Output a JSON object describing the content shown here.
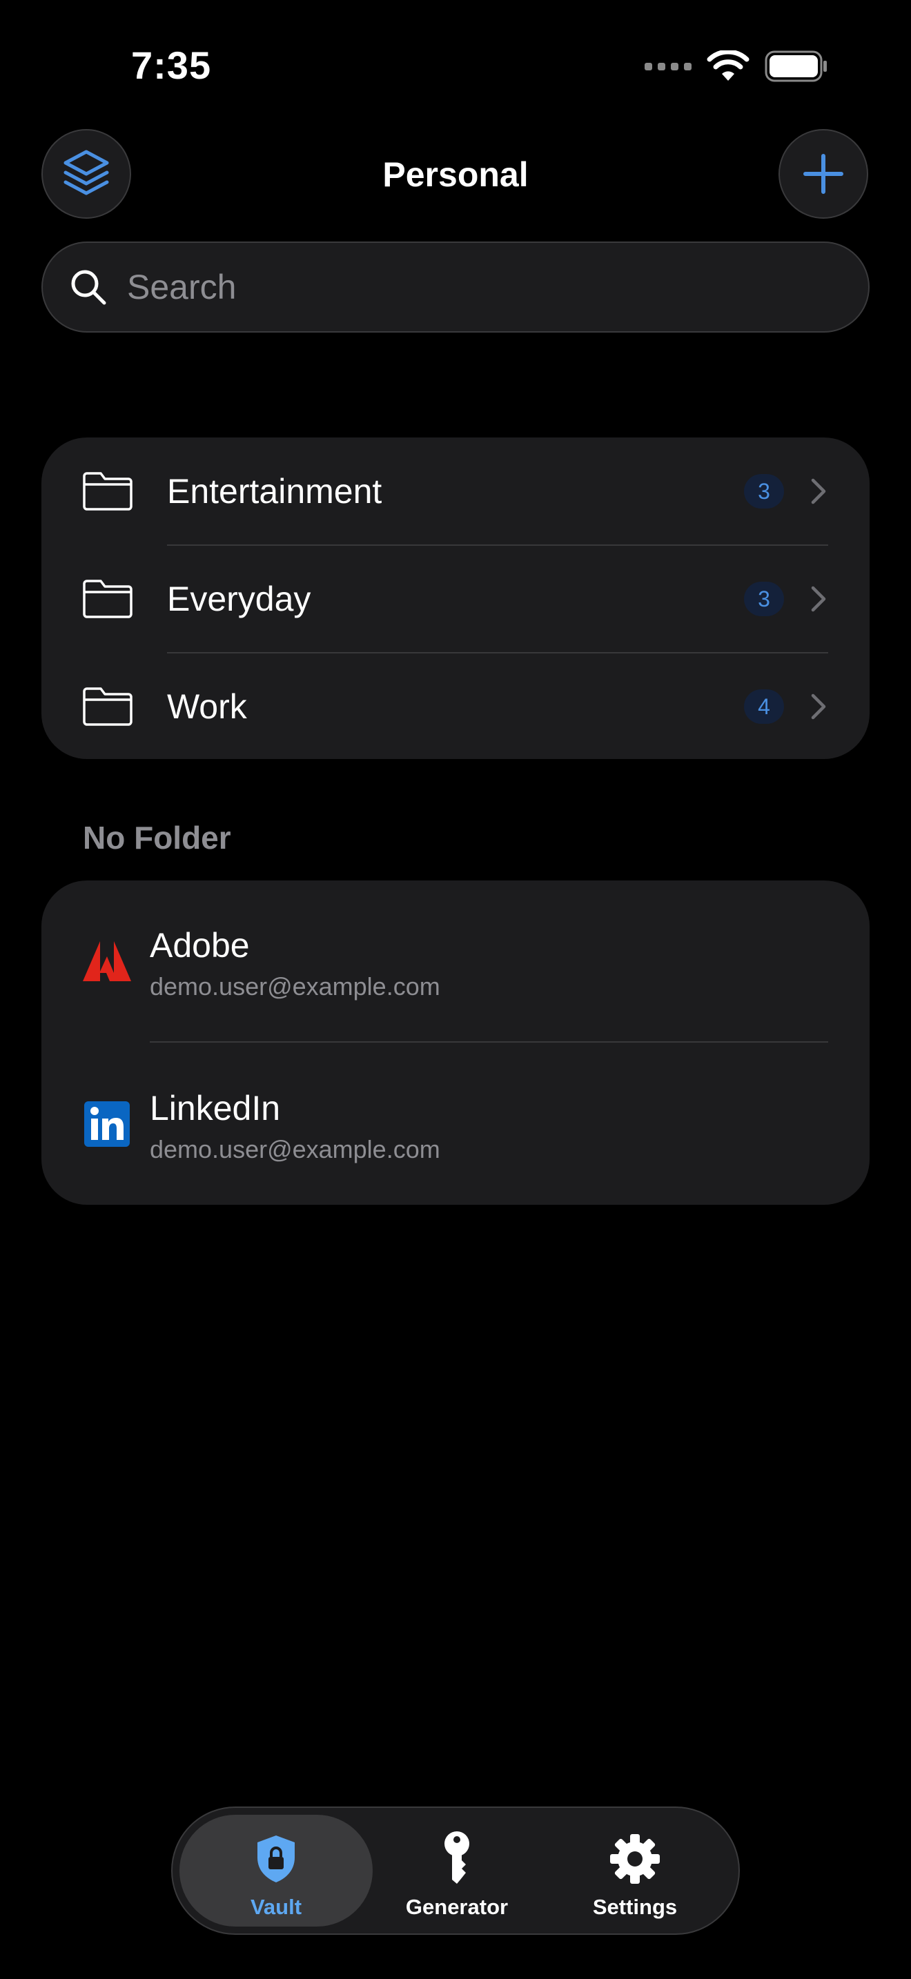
{
  "status_bar": {
    "time": "7:35"
  },
  "header": {
    "title": "Personal",
    "left_icon": "layers-icon",
    "right_icon": "plus-icon"
  },
  "search": {
    "placeholder": "Search",
    "value": ""
  },
  "folders": [
    {
      "label": "Entertainment",
      "count": "3"
    },
    {
      "label": "Everyday",
      "count": "3"
    },
    {
      "label": "Work",
      "count": "4"
    }
  ],
  "no_folder": {
    "title": "No Folder",
    "items": [
      {
        "name": "Adobe",
        "subtitle": "demo.user@example.com",
        "icon": "adobe-logo-icon"
      },
      {
        "name": "LinkedIn",
        "subtitle": "demo.user@example.com",
        "icon": "linkedin-logo-icon"
      }
    ]
  },
  "tabs": [
    {
      "label": "Vault",
      "icon": "shield-lock-icon",
      "active": true
    },
    {
      "label": "Generator",
      "icon": "key-icon",
      "active": false
    },
    {
      "label": "Settings",
      "icon": "gear-icon",
      "active": false
    }
  ],
  "colors": {
    "accent": "#4a90e2",
    "background": "#000000",
    "card": "#1c1c1e",
    "secondary_text": "#8e8e93",
    "adobe_red": "#e1251b",
    "linkedin_blue": "#0a66c2",
    "vault_tab": "#5ea8f2"
  }
}
